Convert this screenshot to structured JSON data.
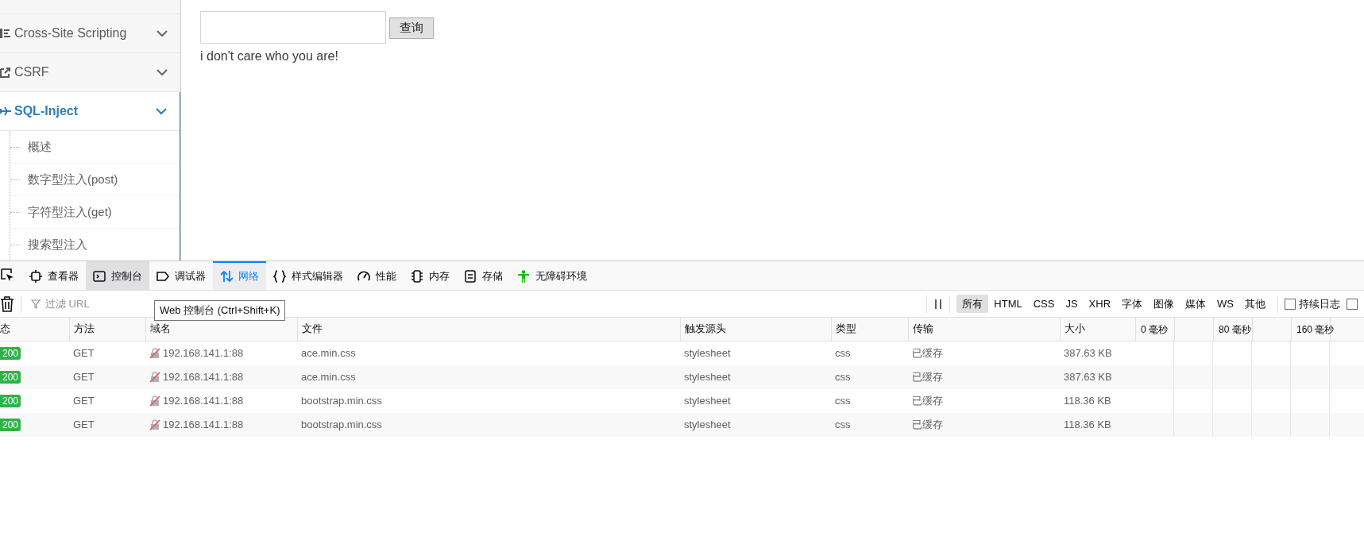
{
  "sidebar": {
    "items": [
      {
        "label": "Cross-Site Scripting",
        "selected": false
      },
      {
        "label": "CSRF",
        "selected": false
      },
      {
        "label": "SQL-Inject",
        "selected": true,
        "children": [
          {
            "label": "概述"
          },
          {
            "label": "数字型注入(post)"
          },
          {
            "label": "字符型注入(get)"
          },
          {
            "label": "搜索型注入"
          }
        ]
      }
    ]
  },
  "main": {
    "query_button": "查询",
    "message": "i don't care who you are!"
  },
  "devtools": {
    "tabs": [
      {
        "label": "查看器",
        "selected": false,
        "hovered": false
      },
      {
        "label": "控制台",
        "selected": false,
        "hovered": true
      },
      {
        "label": "调试器",
        "selected": false,
        "hovered": false
      },
      {
        "label": "网络",
        "selected": true,
        "hovered": false
      },
      {
        "label": "样式编辑器",
        "selected": false,
        "hovered": false
      },
      {
        "label": "性能",
        "selected": false,
        "hovered": false
      },
      {
        "label": "内存",
        "selected": false,
        "hovered": false
      },
      {
        "label": "存储",
        "selected": false,
        "hovered": false
      },
      {
        "label": "无障碍环境",
        "selected": false,
        "hovered": false
      }
    ],
    "filter": {
      "placeholder": "过滤 URL"
    },
    "tooltip": "Web 控制台 (Ctrl+Shift+K)",
    "type_filters": [
      {
        "label": "所有",
        "selected": true
      },
      {
        "label": "HTML",
        "selected": false
      },
      {
        "label": "CSS",
        "selected": false
      },
      {
        "label": "JS",
        "selected": false
      },
      {
        "label": "XHR",
        "selected": false
      },
      {
        "label": "字体",
        "selected": false
      },
      {
        "label": "图像",
        "selected": false
      },
      {
        "label": "媒体",
        "selected": false
      },
      {
        "label": "WS",
        "selected": false
      },
      {
        "label": "其他",
        "selected": false
      }
    ],
    "checkboxes": [
      {
        "label": "持续日志",
        "checked": false
      },
      {
        "checked": false
      }
    ],
    "table": {
      "columns": [
        "态",
        "方法",
        "域名",
        "文件",
        "触发源头",
        "类型",
        "传输",
        "大小"
      ],
      "timeline_ticks": [
        "0 毫秒",
        "80 毫秒",
        "160 毫秒"
      ],
      "rows": [
        {
          "status": "200",
          "method": "GET",
          "domain": "192.168.141.1:88",
          "file": "ace.min.css",
          "cause": "stylesheet",
          "type": "css",
          "transferred": "已缓存",
          "size": "387.63 KB"
        },
        {
          "status": "200",
          "method": "GET",
          "domain": "192.168.141.1:88",
          "file": "ace.min.css",
          "cause": "stylesheet",
          "type": "css",
          "transferred": "已缓存",
          "size": "387.63 KB"
        },
        {
          "status": "200",
          "method": "GET",
          "domain": "192.168.141.1:88",
          "file": "bootstrap.min.css",
          "cause": "stylesheet",
          "type": "css",
          "transferred": "已缓存",
          "size": "118.36 KB"
        },
        {
          "status": "200",
          "method": "GET",
          "domain": "192.168.141.1:88",
          "file": "bootstrap.min.css",
          "cause": "stylesheet",
          "type": "css",
          "transferred": "已缓存",
          "size": "118.36 KB"
        }
      ]
    }
  }
}
